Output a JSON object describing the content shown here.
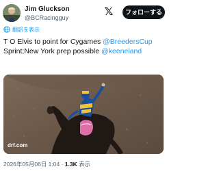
{
  "header": {
    "display_name": "Jim Gluckson",
    "handle": "@BCRacingguy",
    "follow_label": "フォローする",
    "x_logo": "𝕏"
  },
  "translate": {
    "label": "翻訳を表示",
    "icon": "globe-icon"
  },
  "tweet": {
    "text_part1": "T O Elvis to point for Cygames ",
    "mention1": "@BreedersCup",
    "text_part2": " Sprint;New York prep possible ",
    "mention2": "@keeneland"
  },
  "media": {
    "source": "drf.com",
    "description_icon": "horse-race-photo"
  },
  "meta": {
    "timestamp": "2026年05月06日 1:04",
    "separator": " · ",
    "views_count": "1.3K",
    "views_label": " 表示"
  },
  "colors": {
    "link": "#1d9bf0",
    "text": "#0f1419",
    "secondary": "#536471",
    "follow_bg": "#0f1419"
  }
}
